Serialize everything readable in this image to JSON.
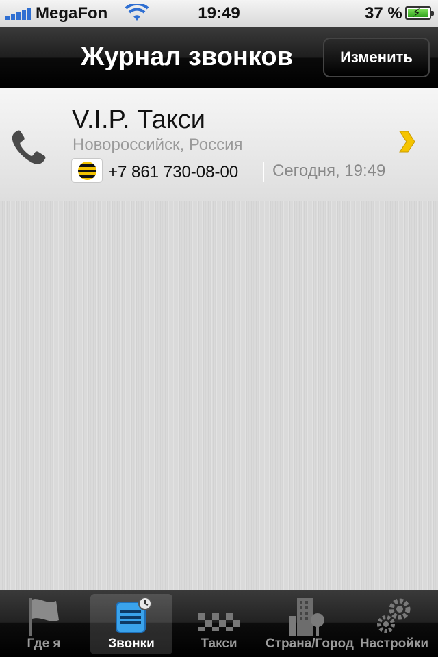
{
  "status_bar": {
    "carrier": "MegaFon",
    "time": "19:49",
    "battery": "37 %",
    "battery_charging": true
  },
  "nav": {
    "title": "Журнал звонков",
    "edit_label": "Изменить"
  },
  "calls": [
    {
      "name": "V.I.P. Такси",
      "location": "Новороссийск, Россия",
      "number": "+7 861 730-08-00",
      "date": "Сегодня, 19:49",
      "operator_icon": "beeline-logo-icon"
    }
  ],
  "tabs": [
    {
      "label": "Где я",
      "icon": "flag-icon",
      "active": false
    },
    {
      "label": "Звонки",
      "icon": "calls-log-icon",
      "active": true
    },
    {
      "label": "Такси",
      "icon": "taxi-checker-icon",
      "active": false
    },
    {
      "label": "Страна/Город",
      "icon": "city-icon",
      "active": false
    },
    {
      "label": "Настройки",
      "icon": "gears-icon",
      "active": false
    }
  ],
  "colors": {
    "accent_blue": "#2f6fd2",
    "chevron_yellow": "#f5c400",
    "battery_green": "#4cc334"
  }
}
